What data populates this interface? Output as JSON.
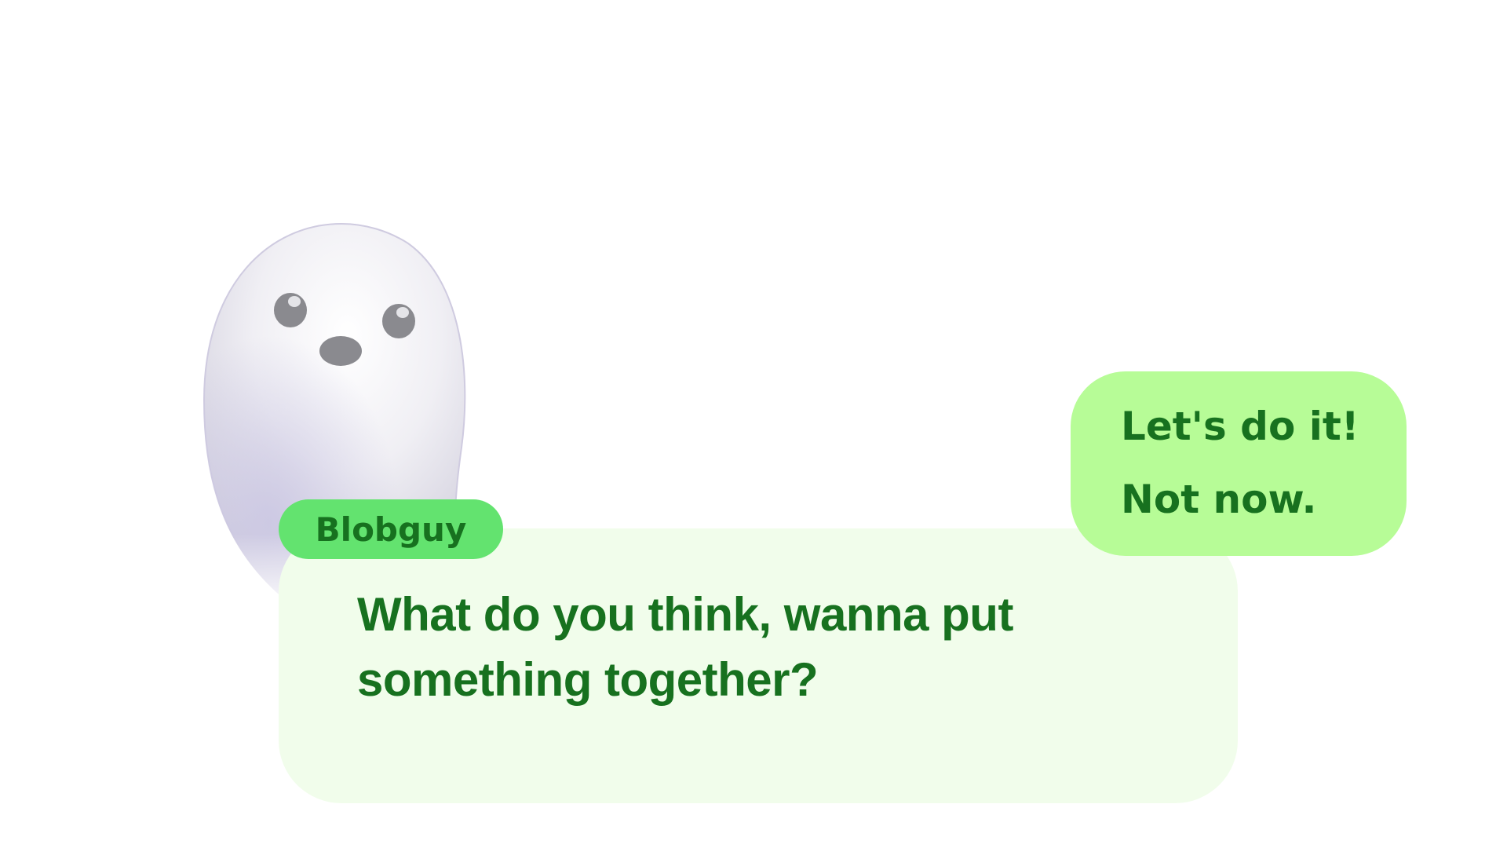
{
  "character": {
    "name": "Blobguy",
    "sprite_icon": "ghost-blob-icon"
  },
  "dialogue": {
    "text": "What do you think, wanna put something together?"
  },
  "choices": [
    {
      "label": "Let's do it!"
    },
    {
      "label": "Not now."
    }
  ],
  "colors": {
    "background": "#ffffff",
    "dialogue_box": "#f1fdeb",
    "name_tag": "#63e36f",
    "choice_panel": "#b7fc97",
    "text": "#17711f"
  }
}
